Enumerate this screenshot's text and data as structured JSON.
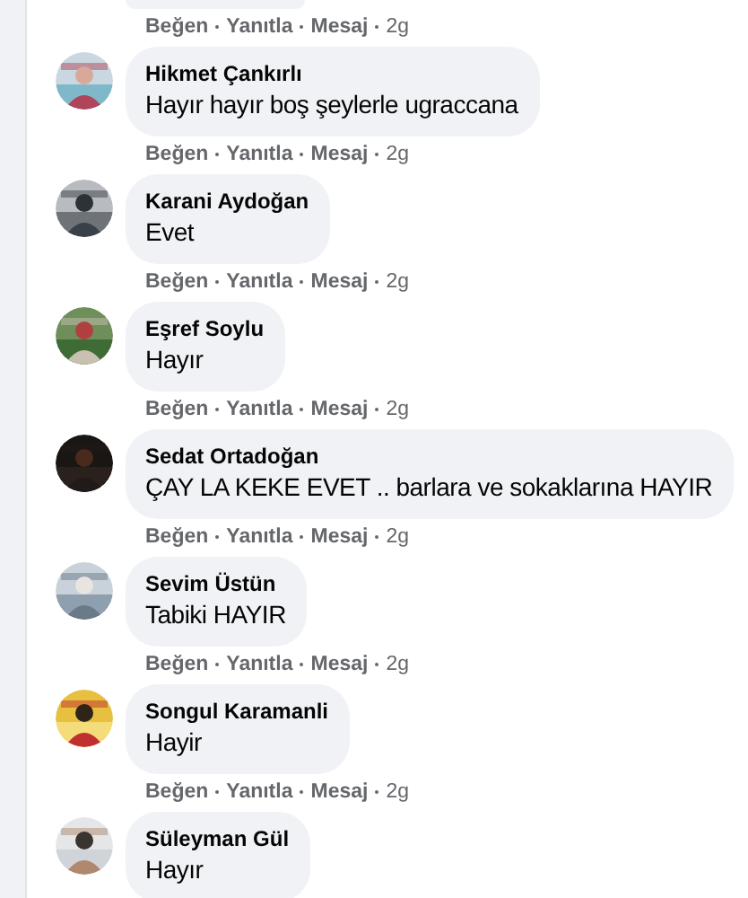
{
  "top_actions": {
    "links": [
      "Beğen",
      "Yanıtla",
      "Mesaj"
    ],
    "time": "2g"
  },
  "comments": [
    {
      "author": "Hikmet Çankırlı",
      "text": "Hayır hayır boş şeylerle ugraccana",
      "actions": {
        "links": [
          "Beğen",
          "Yanıtla",
          "Mesaj"
        ],
        "time": "2g"
      }
    },
    {
      "author": "Karani Aydoğan",
      "text": "Evet",
      "actions": {
        "links": [
          "Beğen",
          "Yanıtla",
          "Mesaj"
        ],
        "time": "2g"
      }
    },
    {
      "author": "Eşref Soylu",
      "text": "Hayır",
      "actions": {
        "links": [
          "Beğen",
          "Yanıtla",
          "Mesaj"
        ],
        "time": "2g"
      }
    },
    {
      "author": "Sedat Ortadoğan",
      "text": "ÇAY LA KEKE EVET .. barlara ve sokaklarına HAYIR",
      "actions": {
        "links": [
          "Beğen",
          "Yanıtla",
          "Mesaj"
        ],
        "time": "2g"
      }
    },
    {
      "author": "Sevim Üstün",
      "text": "Tabiki HAYIR",
      "actions": {
        "links": [
          "Beğen",
          "Yanıtla",
          "Mesaj"
        ],
        "time": "2g"
      }
    },
    {
      "author": "Songul Karamanli",
      "text": "Hayir",
      "actions": {
        "links": [
          "Beğen",
          "Yanıtla",
          "Mesaj"
        ],
        "time": "2g"
      }
    },
    {
      "author": "Süleyman Gül",
      "text": "Hayır"
    }
  ]
}
